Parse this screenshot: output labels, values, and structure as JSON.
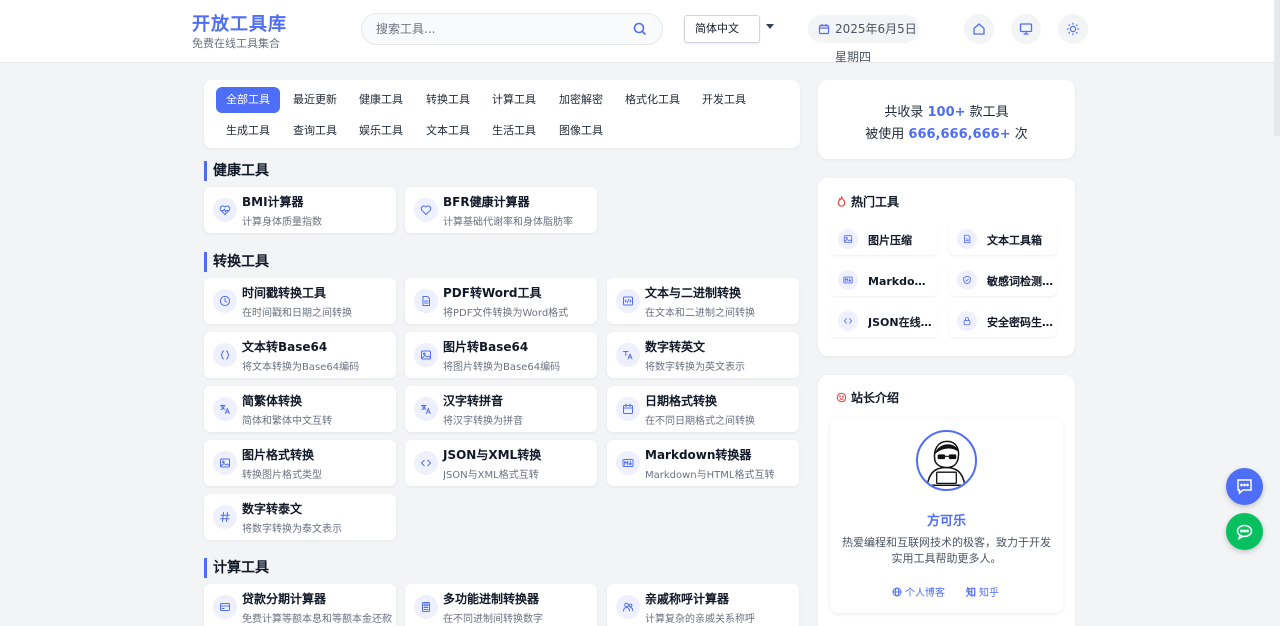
{
  "header": {
    "title": "开放工具库",
    "subtitle": "免费在线工具集合",
    "search_placeholder": "搜索工具...",
    "language": "简体中文",
    "date": "2025年6月5日星期四",
    "buttons": [
      "home-icon",
      "monitor-icon",
      "sun-icon"
    ]
  },
  "categories": [
    "全部工具",
    "最近更新",
    "健康工具",
    "转换工具",
    "计算工具",
    "加密解密",
    "格式化工具",
    "开发工具",
    "生成工具",
    "查询工具",
    "娱乐工具",
    "文本工具",
    "生活工具",
    "图像工具"
  ],
  "active_category": "全部工具",
  "sections": [
    {
      "title": "健康工具",
      "tools": [
        {
          "name": "BMI计算器",
          "desc": "计算身体质量指数",
          "icon": "heart-pulse-icon"
        },
        {
          "name": "BFR健康计算器",
          "desc": "计算基础代谢率和身体脂肪率",
          "icon": "heart-icon"
        }
      ]
    },
    {
      "title": "转换工具",
      "tools": [
        {
          "name": "时间戳转换工具",
          "desc": "在时间戳和日期之间转换",
          "icon": "clock-icon"
        },
        {
          "name": "PDF转Word工具",
          "desc": "将PDF文件转换为Word格式",
          "icon": "document-icon"
        },
        {
          "name": "文本与二进制转换",
          "desc": "在文本和二进制之间转换",
          "icon": "binary-icon"
        },
        {
          "name": "文本转Base64",
          "desc": "将文本转换为Base64编码",
          "icon": "braces-icon"
        },
        {
          "name": "图片转Base64",
          "desc": "将图片转换为Base64编码",
          "icon": "image-icon"
        },
        {
          "name": "数字转英文",
          "desc": "将数字转换为英文表示",
          "icon": "number-text-icon"
        },
        {
          "name": "简繁体转换",
          "desc": "简体和繁体中文互转",
          "icon": "translate-icon"
        },
        {
          "name": "汉字转拼音",
          "desc": "将汉字转换为拼音",
          "icon": "language-icon"
        },
        {
          "name": "日期格式转换",
          "desc": "在不同日期格式之间转换",
          "icon": "calendar-icon"
        },
        {
          "name": "图片格式转换",
          "desc": "转换图片格式类型",
          "icon": "picture-icon"
        },
        {
          "name": "JSON与XML转换",
          "desc": "JSON与XML格式互转",
          "icon": "code-icon"
        },
        {
          "name": "Markdown转换器",
          "desc": "Markdown与HTML格式互转",
          "icon": "markdown-icon"
        },
        {
          "name": "数字转泰文",
          "desc": "将数字转换为泰文表示",
          "icon": "hash-icon"
        }
      ]
    },
    {
      "title": "计算工具",
      "tools": [
        {
          "name": "贷款分期计算器",
          "desc": "免费计算等额本息和等额本金还款",
          "icon": "credit-card-icon"
        },
        {
          "name": "多功能进制转换器",
          "desc": "在不同进制间转换数字",
          "icon": "calculator-icon"
        },
        {
          "name": "亲戚称呼计算器",
          "desc": "计算复杂的亲戚关系称呼",
          "icon": "users-icon"
        }
      ]
    }
  ],
  "stats": {
    "line1_prefix": "共收录 ",
    "line1_num": "100+",
    "line1_suffix": " 款工具",
    "line2_prefix": "被使用 ",
    "line2_num": "666,666,666+",
    "line2_suffix": " 次"
  },
  "hot": {
    "title": "热门工具",
    "items": [
      {
        "label": "图片压缩",
        "icon": "image-icon"
      },
      {
        "label": "文本工具箱",
        "icon": "document-icon"
      },
      {
        "label": "Markdown转换器",
        "icon": "markdown-icon"
      },
      {
        "label": "敏感词检测工具",
        "icon": "shield-icon"
      },
      {
        "label": "JSON在线格式化",
        "icon": "code-icon"
      },
      {
        "label": "安全密码生成器",
        "icon": "lock-icon"
      }
    ]
  },
  "about": {
    "title": "站长介绍",
    "name": "方可乐",
    "desc": "热爱编程和互联网技术的极客，致力于开发实用工具帮助更多人。",
    "link_blog": "个人博客",
    "link_zhihu": "知乎"
  },
  "colors": {
    "accent": "#4f6ef7",
    "wechat": "#07c160",
    "hot": "#ef4444"
  }
}
